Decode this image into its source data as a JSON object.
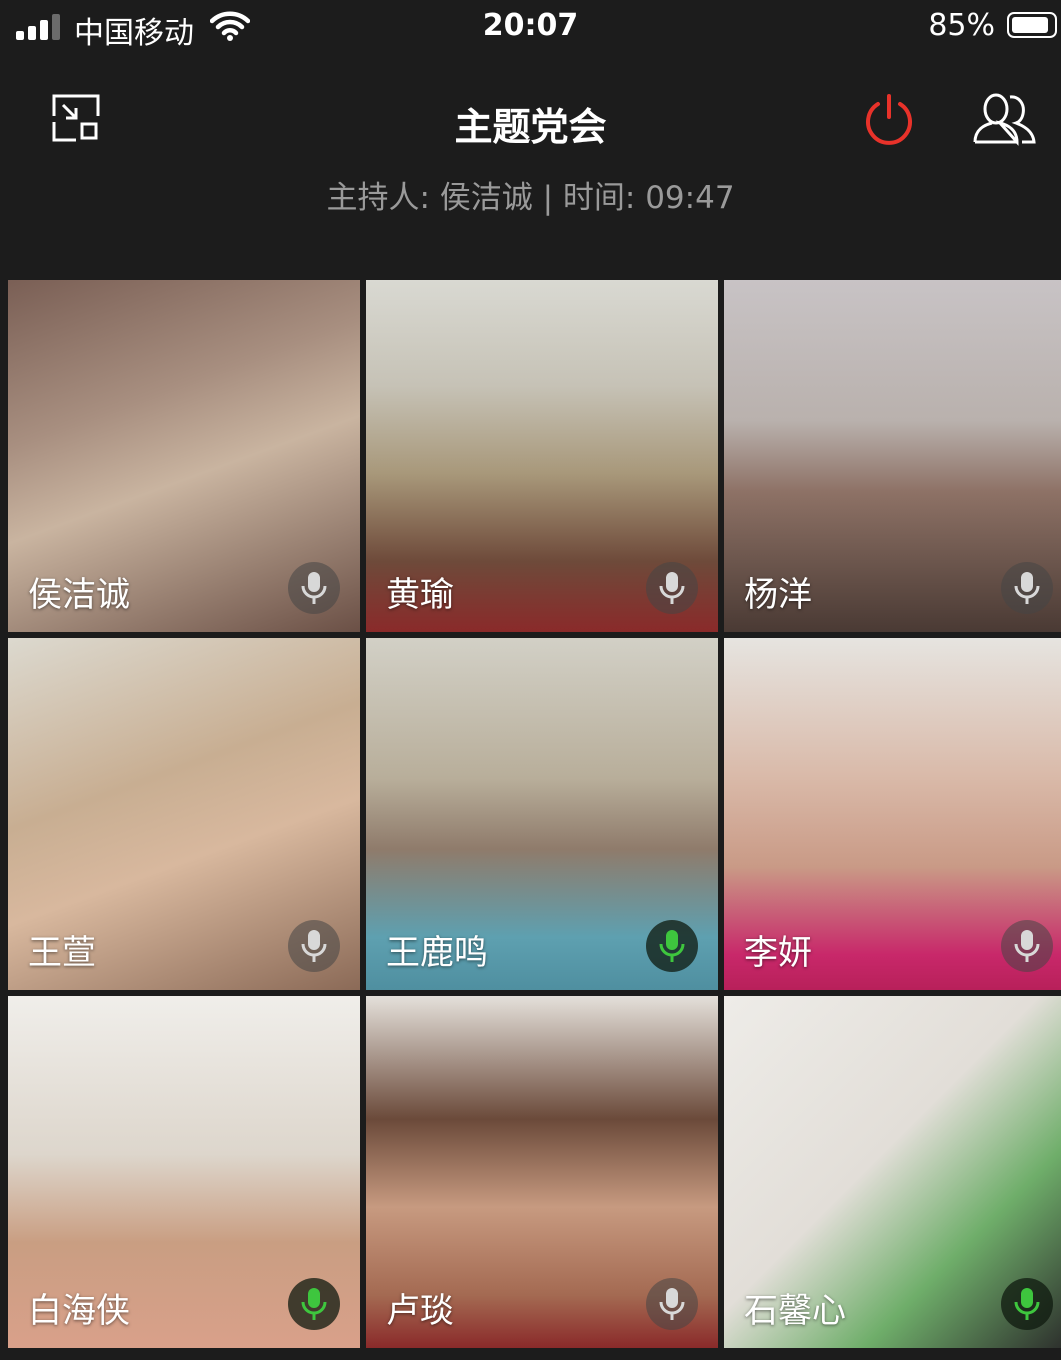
{
  "status_bar": {
    "carrier": "中国移动",
    "time": "20:07",
    "battery": "85%",
    "battery_level": 0.85
  },
  "header": {
    "title": "主题党会",
    "subtitle": "主持人: 侯洁诚 | 时间: 09:47",
    "minimize_icon": "minimize-window-icon",
    "leave_icon": "power-icon",
    "members_icon": "participants-icon",
    "leave_color": "#e8322a"
  },
  "participants": [
    {
      "name": "侯洁诚",
      "mic": "muted"
    },
    {
      "name": "黄瑜",
      "mic": "muted"
    },
    {
      "name": "杨洋",
      "mic": "muted"
    },
    {
      "name": "王萱",
      "mic": "muted"
    },
    {
      "name": "王鹿鸣",
      "mic": "active"
    },
    {
      "name": "李妍",
      "mic": "muted"
    },
    {
      "name": "白海侠",
      "mic": "active"
    },
    {
      "name": "卢琰",
      "mic": "muted"
    },
    {
      "name": "石馨心",
      "mic": "active"
    }
  ],
  "colors": {
    "background": "#1c1c1c",
    "mic_active": "#3ec63e",
    "mic_muted": "#d8d8d8",
    "subtitle": "#9a9a9a"
  }
}
